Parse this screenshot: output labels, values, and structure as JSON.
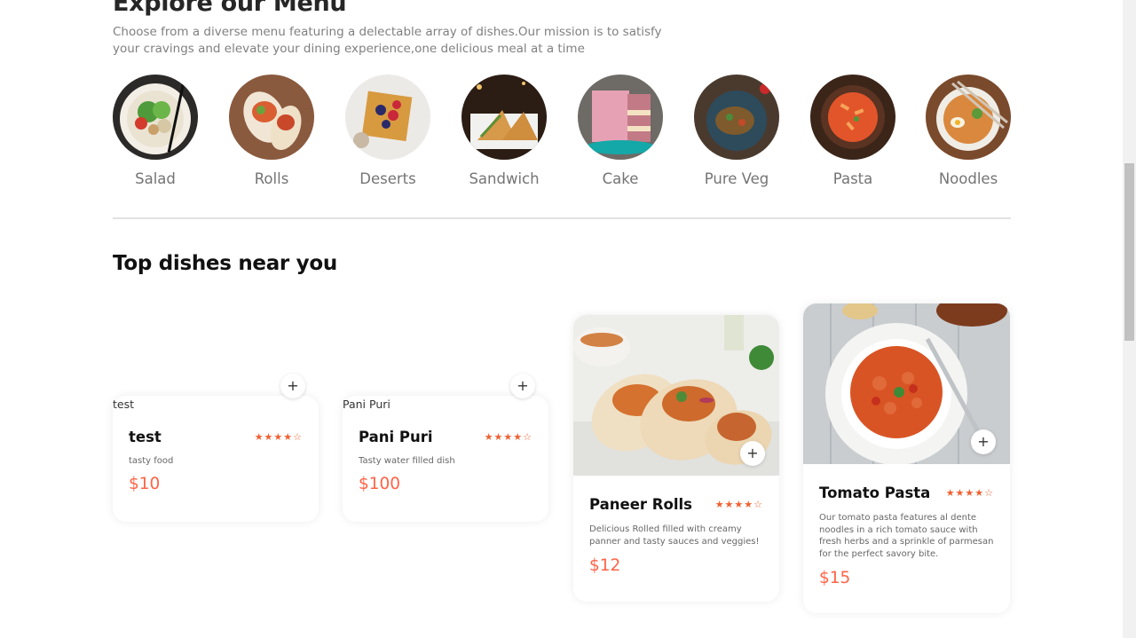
{
  "menu": {
    "title": "Explore our Menu",
    "description": "Choose from a diverse menu featuring a delectable array of dishes.Our mission is to satisfy your cravings and elevate your dining experience,one delicious meal at a time",
    "categories": [
      {
        "label": "Salad",
        "icon": "salad-bowl-image"
      },
      {
        "label": "Rolls",
        "icon": "rolls-image"
      },
      {
        "label": "Deserts",
        "icon": "waffle-dessert-image"
      },
      {
        "label": "Sandwich",
        "icon": "sandwich-image"
      },
      {
        "label": "Cake",
        "icon": "cake-image"
      },
      {
        "label": "Pure Veg",
        "icon": "veg-dish-image"
      },
      {
        "label": "Pasta",
        "icon": "pasta-image"
      },
      {
        "label": "Noodles",
        "icon": "noodles-image"
      }
    ]
  },
  "top_dishes": {
    "title": "Top dishes near you",
    "items": [
      {
        "name": "test",
        "alt": "test",
        "description": "tasty food",
        "price": "$10",
        "rating": "★★★★☆",
        "image": "broken-image"
      },
      {
        "name": "Pani Puri",
        "alt": "Pani Puri",
        "description": "Tasty water filled dish",
        "price": "$100",
        "rating": "★★★★☆",
        "image": "broken-image"
      },
      {
        "name": "Paneer Rolls",
        "description": "Delicious Rolled filled with creamy panner and tasty sauces and veggies!",
        "price": "$12",
        "rating": "★★★★☆",
        "image": "paneer-rolls-image"
      },
      {
        "name": "Tomato Pasta",
        "description": "Our tomato pasta features al dente noodles in a rich tomato sauce with fresh herbs and a sprinkle of parmesan for the perfect savory bite.",
        "price": "$15",
        "rating": "★★★★☆",
        "image": "tomato-pasta-image"
      }
    ],
    "add_symbol": "+"
  },
  "colors": {
    "accent": "#ff6346",
    "star": "#f06030",
    "heading": "#262626",
    "muted": "#808080"
  }
}
